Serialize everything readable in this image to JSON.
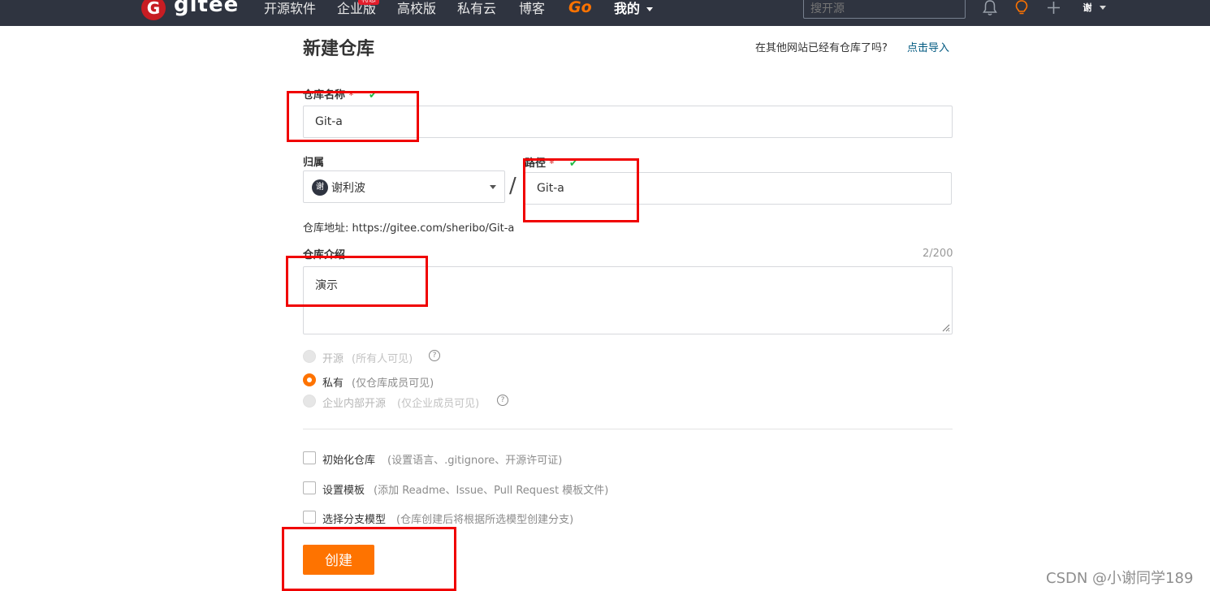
{
  "nav": {
    "logo_mark": "G",
    "brand": "gitee",
    "items": [
      "开源软件",
      "企业版",
      "高校版",
      "私有云",
      "博客"
    ],
    "hot_badge": "特惠",
    "go_label": "Go",
    "mine_label": "我的",
    "search_placeholder": "搜开源",
    "avatar_text": "谢"
  },
  "form": {
    "title": "新建仓库",
    "import_question": "在其他网站已经有仓库了吗?",
    "import_link": "点击导入",
    "name_label": "仓库名称",
    "required_mark": "*",
    "check_mark": "✔",
    "name_value": "Git-a",
    "owner_label": "归属",
    "owner_avatar": "谢",
    "owner_name": "谢利波",
    "slash": "/",
    "path_label": "路径",
    "path_value": "Git-a",
    "address_prefix": "仓库地址:",
    "address_url": "https://gitee.com/sheribo/Git-a",
    "desc_label": "仓库介绍",
    "desc_counter": "2/200",
    "desc_value": "演示",
    "visibility": [
      {
        "label": "开源",
        "hint": "(所有人可见)",
        "selected": false
      },
      {
        "label": "私有",
        "hint": "(仅仓库成员可见)",
        "selected": true
      },
      {
        "label": "企业内部开源",
        "hint": "(仅企业成员可见)",
        "selected": false
      }
    ],
    "options": [
      {
        "label": "初始化仓库",
        "hint": "(设置语言、.gitignore、开源许可证)",
        "checked": false
      },
      {
        "label": "设置模板",
        "hint": "(添加 Readme、Issue、Pull Request 模板文件)",
        "checked": false
      },
      {
        "label": "选择分支模型",
        "hint": "(仓库创建后将根据所选模型创建分支)",
        "checked": false
      }
    ],
    "submit_label": "创建"
  },
  "watermark": "CSDN @小谢同学189",
  "colors": {
    "nav_bg": "#2f3440",
    "accent": "#fe7300",
    "brand_red": "#c71d23",
    "annotation_red": "#f00000",
    "link": "#005980"
  }
}
